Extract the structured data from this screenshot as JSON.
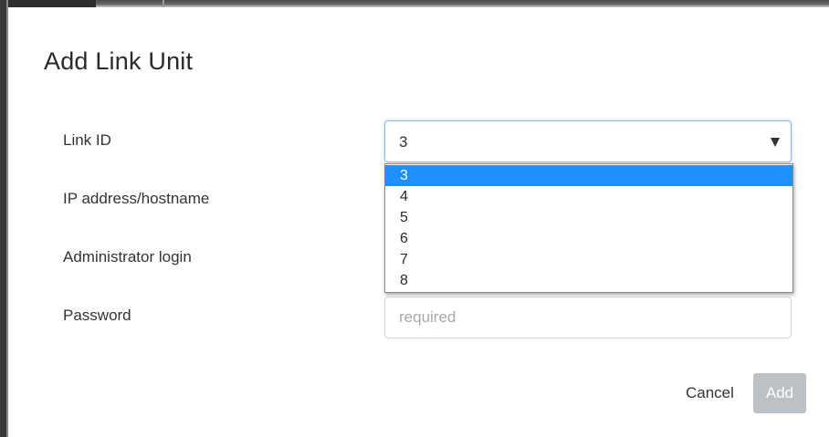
{
  "dialog": {
    "title": "Add Link Unit"
  },
  "form": {
    "link_id": {
      "label": "Link ID",
      "value": "3",
      "options": [
        "3",
        "4",
        "5",
        "6",
        "7",
        "8"
      ],
      "selected_index": 0
    },
    "ip_address": {
      "label": "IP address/hostname"
    },
    "admin_login": {
      "label": "Administrator login"
    },
    "password": {
      "label": "Password",
      "placeholder": "required"
    }
  },
  "actions": {
    "cancel_label": "Cancel",
    "add_label": "Add"
  },
  "colors": {
    "selected_option": "#1e90ff",
    "disabled_button": "#bcc1c6",
    "focus_border": "#8cb9ec"
  }
}
